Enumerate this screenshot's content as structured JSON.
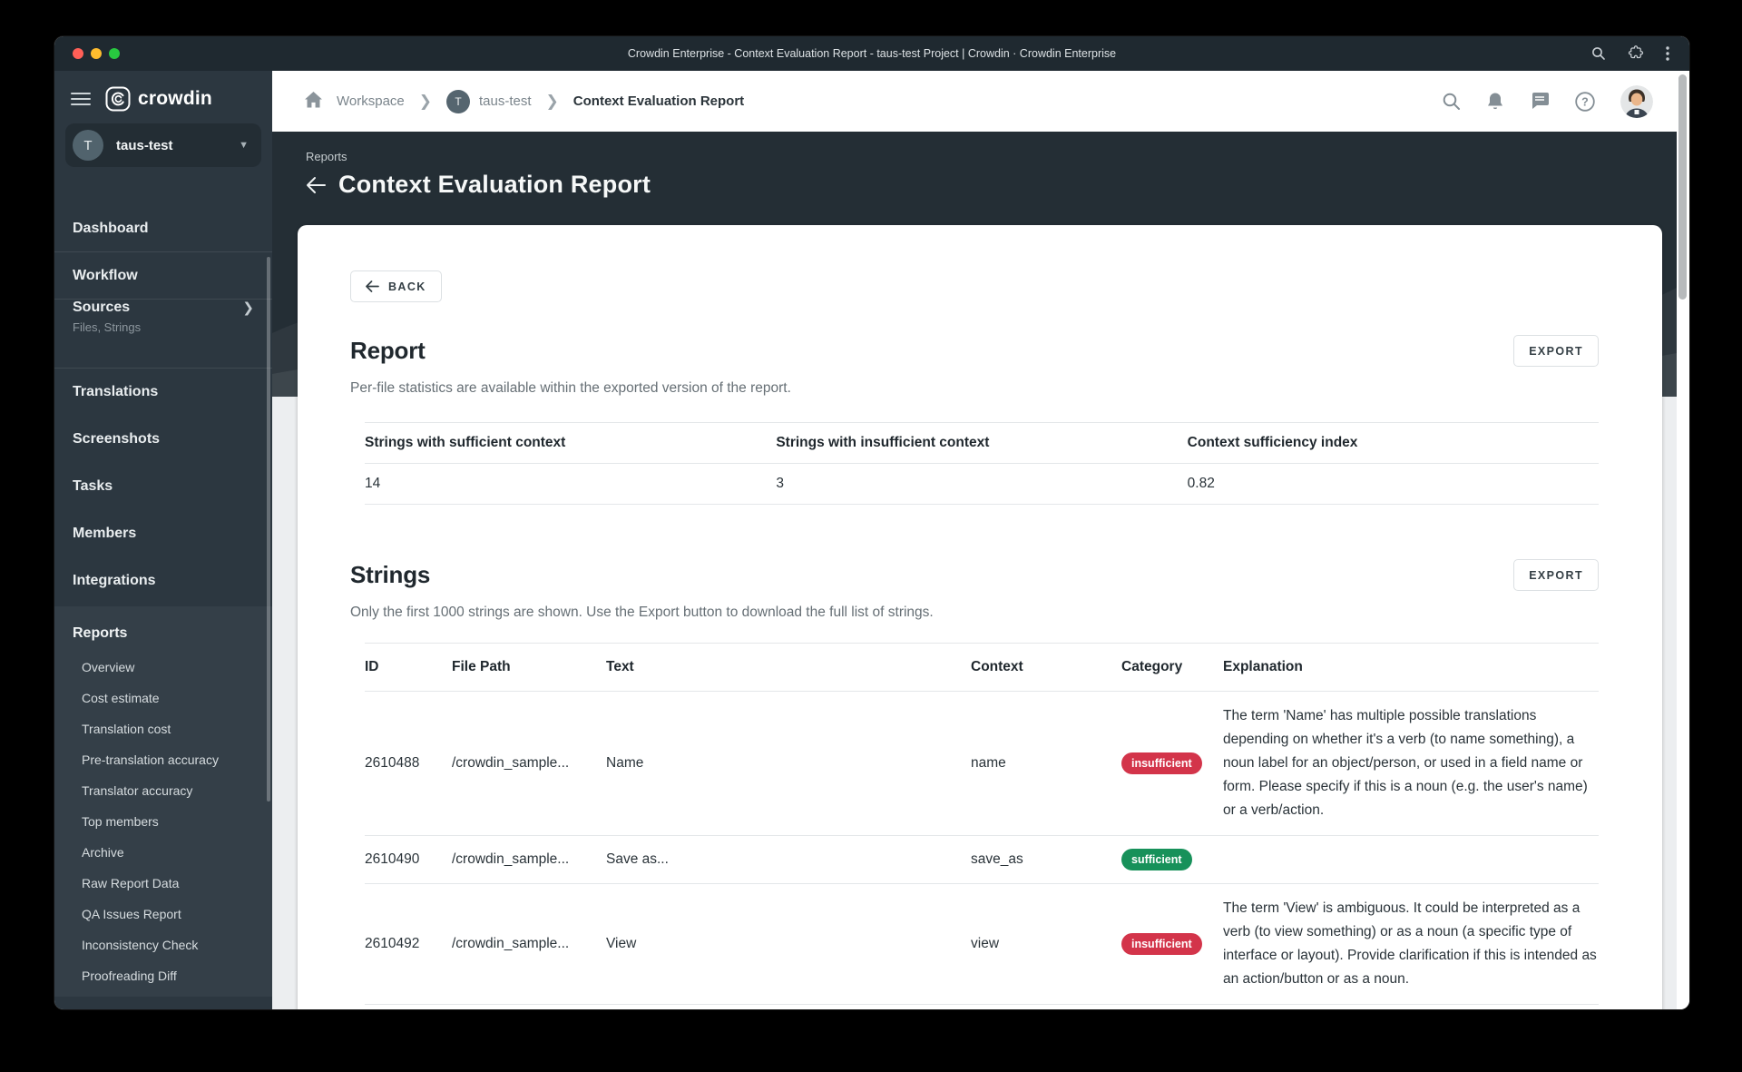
{
  "window": {
    "title": "Crowdin Enterprise - Context Evaluation Report - taus-test Project | Crowdin · Crowdin Enterprise"
  },
  "brand": {
    "logo_text": "crowdin"
  },
  "sidebar": {
    "project": {
      "initial": "T",
      "name": "taus-test"
    },
    "items": [
      {
        "label": "Dashboard"
      },
      {
        "label": "Workflow"
      },
      {
        "label": "Sources",
        "sub": "Files, Strings"
      },
      {
        "label": "Translations"
      },
      {
        "label": "Screenshots"
      },
      {
        "label": "Tasks"
      },
      {
        "label": "Members"
      },
      {
        "label": "Integrations"
      }
    ],
    "reports": {
      "label": "Reports",
      "subitems": [
        {
          "label": "Overview"
        },
        {
          "label": "Cost estimate"
        },
        {
          "label": "Translation cost"
        },
        {
          "label": "Pre-translation accuracy"
        },
        {
          "label": "Translator accuracy"
        },
        {
          "label": "Top members"
        },
        {
          "label": "Archive"
        },
        {
          "label": "Raw Report Data"
        },
        {
          "label": "QA Issues Report"
        },
        {
          "label": "Inconsistency Check"
        },
        {
          "label": "Proofreading Diff"
        }
      ]
    }
  },
  "breadcrumb": {
    "workspace": "Workspace",
    "project_initial": "T",
    "project": "taus-test",
    "current": "Context Evaluation Report"
  },
  "hero": {
    "eyebrow": "Reports",
    "title": "Context Evaluation Report"
  },
  "report": {
    "back_label": "BACK",
    "title": "Report",
    "subtitle": "Per-file statistics are available within the exported version of the report.",
    "export_label": "EXPORT",
    "stats": {
      "headers": [
        "Strings with sufficient context",
        "Strings with insufficient context",
        "Context sufficiency index"
      ],
      "values": [
        "14",
        "3",
        "0.82"
      ]
    }
  },
  "strings": {
    "title": "Strings",
    "subtitle": "Only the first 1000 strings are shown. Use the Export button to download the full list of strings.",
    "export_label": "EXPORT",
    "columns": [
      "ID",
      "File Path",
      "Text",
      "Context",
      "Category",
      "Explanation"
    ],
    "rows": [
      {
        "id": "2610488",
        "file_path": "/crowdin_sample...",
        "text": "Name",
        "context": "name",
        "category": "insufficient",
        "explanation": "The term 'Name' has multiple possible translations depending on whether it's a verb (to name something), a noun label for an object/person, or used in a field name or form. Please specify if this is a noun (e.g. the user's name) or a verb/action."
      },
      {
        "id": "2610490",
        "file_path": "/crowdin_sample...",
        "text": "Save as...",
        "context": "save_as",
        "category": "sufficient",
        "explanation": ""
      },
      {
        "id": "2610492",
        "file_path": "/crowdin_sample...",
        "text": "View",
        "context": "view",
        "category": "insufficient",
        "explanation": "The term 'View' is ambiguous. It could be interpreted as a verb (to view something) or as a noun (a specific type of interface or layout). Provide clarification if this is intended as an action/button or as a noun."
      }
    ]
  },
  "colors": {
    "badge_insufficient": "#d3344a",
    "badge_sufficient": "#17915a",
    "titlebar": "#1f2930",
    "sidebar": "#2c3740",
    "hero": "#242e35"
  },
  "icons": {
    "titlebar": [
      "search-icon",
      "extensions-puzzle-icon",
      "kebab-menu-icon"
    ],
    "topbar": [
      "search-icon",
      "bell-icon",
      "chat-icon",
      "help-icon",
      "user-avatar"
    ],
    "sidebar": [
      "hamburger-icon",
      "crowdin-logo",
      "chevron-right-icon",
      "chevron-down-icon"
    ]
  }
}
